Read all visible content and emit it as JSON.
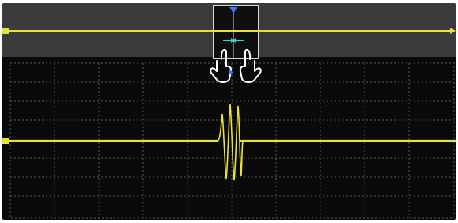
{
  "screen": {
    "colors": {
      "background": "#0a0a0a",
      "overview_background": "#3b3b3b",
      "trace": "#e8e23a",
      "marker": "#3a7bff",
      "grid": "#5a5a5a",
      "zoom_window_border": "#d7d7d7"
    },
    "icons": {
      "left_hand": "hand-icon",
      "right_hand": "hand-icon",
      "pinch_arrows": "pinch-arrows-icon",
      "trigger_marker": "triangle-down-icon",
      "channel_marker": "channel-1-marker-icon"
    }
  }
}
